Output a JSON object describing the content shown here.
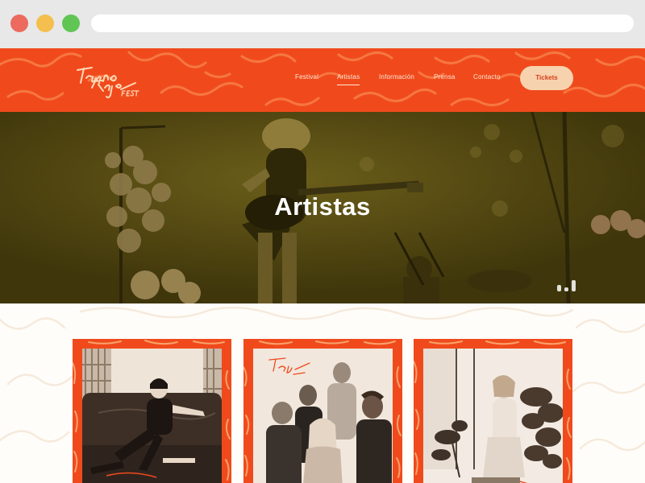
{
  "browser": {
    "buttons": [
      "close",
      "minimize",
      "maximize"
    ],
    "address": ""
  },
  "header": {
    "logo_icon": "trueno-rayo-fest-logo",
    "nav": [
      {
        "label": "Festival",
        "active": false
      },
      {
        "label": "Artistas",
        "active": true
      },
      {
        "label": "Información",
        "active": false
      },
      {
        "label": "Prensa",
        "active": false
      },
      {
        "label": "Contacto",
        "active": false
      }
    ],
    "tickets_label": "Tickets"
  },
  "hero": {
    "title": "Artistas",
    "indicator_icon": "slider-bars-icon"
  },
  "artists": [
    {
      "name": "",
      "photo_icon": "artist-photo-woman-on-sofa"
    },
    {
      "name": "",
      "photo_icon": "artist-photo-band-group"
    },
    {
      "name": "",
      "photo_icon": "artist-photo-woman-with-plants"
    }
  ],
  "colors": {
    "brand_orange": "#f04a1c",
    "tickets_bg": "#f7d2ae",
    "nav_text": "#ffe8d6",
    "hero_tint": "#4a3f0c"
  }
}
